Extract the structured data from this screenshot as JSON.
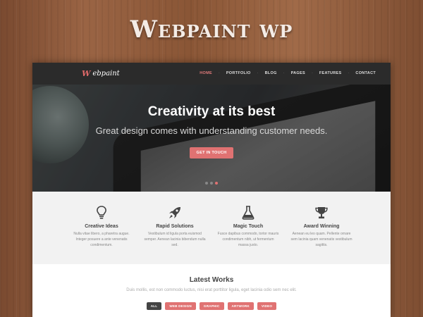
{
  "page_title": "Webpaint wp",
  "logo": {
    "text": "ebpaint",
    "mark": "W"
  },
  "nav": [
    {
      "label": "HOME",
      "active": true
    },
    {
      "label": "PORTFOLIO",
      "active": false
    },
    {
      "label": "BLOG",
      "active": false
    },
    {
      "label": "PAGES",
      "active": false
    },
    {
      "label": "FEATURES",
      "active": false
    },
    {
      "label": "CONTACT",
      "active": false
    }
  ],
  "hero": {
    "heading": "Creativity at its best",
    "subheading": "Great design comes with understanding customer needs.",
    "button": "GET IN TOUCH",
    "slides": 3,
    "active_slide": 3
  },
  "features": [
    {
      "icon": "lightbulb-icon",
      "title": "Creative Ideas",
      "text": "Nulla vitae libero, a pharetra augue. Integer posuere a ante venenatis condimentum."
    },
    {
      "icon": "rocket-icon",
      "title": "Rapid Solutions",
      "text": "Vestibulum id ligula porta euismod semper. Aenean lacinia bibendum nulla sed."
    },
    {
      "icon": "flask-icon",
      "title": "Magic Touch",
      "text": "Fusce dapibus commodo, tortor mauris condimentum nibh, ut fermentum massa justo."
    },
    {
      "icon": "trophy-icon",
      "title": "Award Winning",
      "text": "Aenean eu leo quam. Pellente ornare sem lacinia quam venenatis vestibulum sagittis."
    }
  ],
  "works": {
    "title": "Latest Works",
    "subtitle": "Duis mollis, est non commodo luctus, nisi erat porttitor ligula, eget lacinia odio sem nec elit.",
    "filters": [
      "ALL",
      "WEB DESIGN",
      "GRAPHIC",
      "ARTWORK",
      "VIDEO"
    ],
    "active_filter": "ALL"
  },
  "colors": {
    "accent": "#e07272",
    "nav_bg": "#2b2b2b",
    "features_bg": "#f2f2f2"
  }
}
